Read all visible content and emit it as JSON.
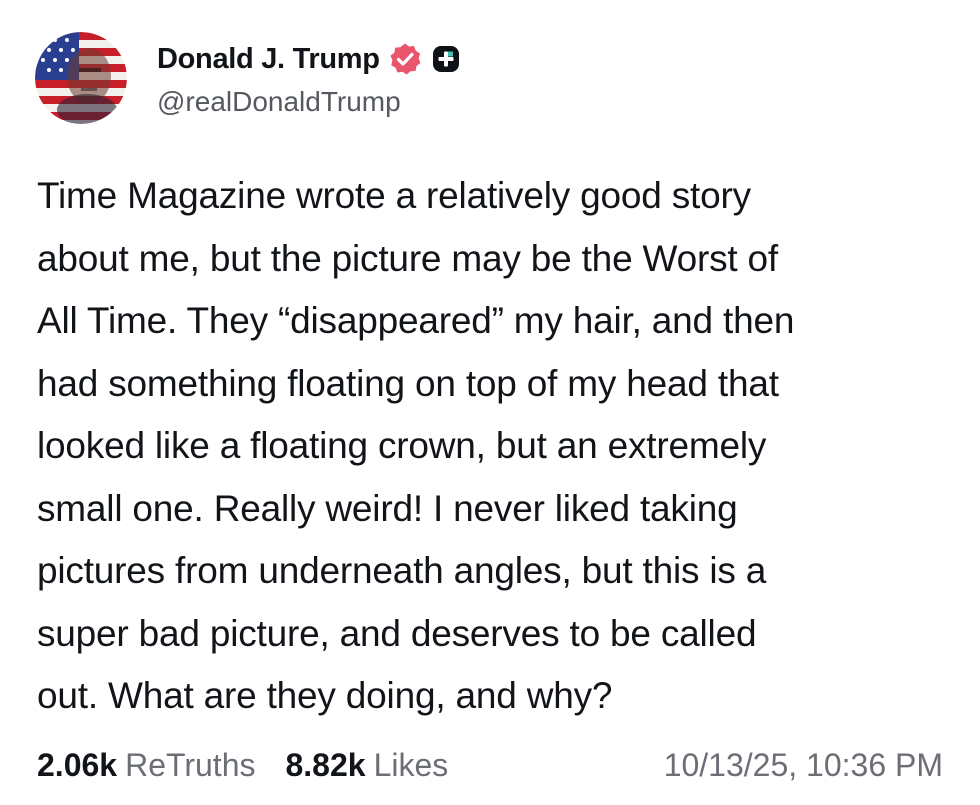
{
  "author": {
    "display_name": "Donald J. Trump",
    "handle": "@realDonaldTrump",
    "avatar_icon": "flag-portrait-avatar",
    "verified_icon": "verified-badge-icon",
    "verified_color": "#e9556a",
    "extra_badge_icon": "plus-badge-icon"
  },
  "post": {
    "lines": [
      "Time Magazine wrote a relatively good story",
      "about me, but the picture may be the Worst of",
      "All Time. They “disappeared” my hair, and then",
      "had something floating on top of my head that",
      "looked like a floating crown, but an extremely",
      "small one. Really weird! I never liked taking",
      "pictures from underneath angles, but this is a",
      "super bad picture, and deserves to be called",
      "out. What are they doing, and why?"
    ]
  },
  "stats": {
    "retruths_count": "2.06k",
    "retruths_label": "ReTruths",
    "likes_count": "8.82k",
    "likes_label": "Likes",
    "timestamp": "10/13/25, 10:36 PM"
  }
}
